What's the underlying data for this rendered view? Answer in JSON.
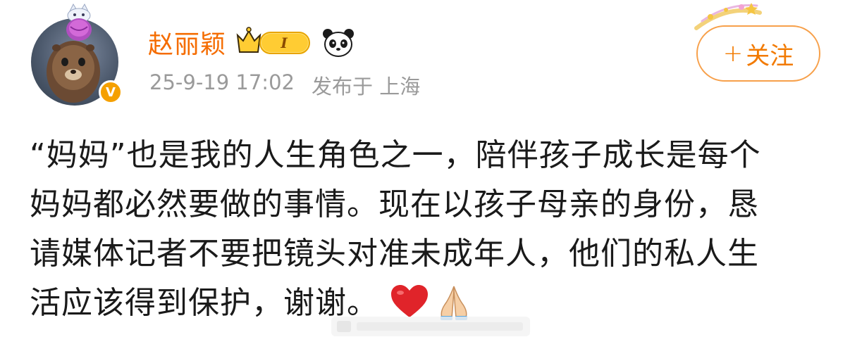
{
  "post": {
    "author": {
      "name": "赵丽颖",
      "level_label": "I",
      "verified_mark": "V"
    },
    "meta": {
      "datetime": "25-9-19 17:02",
      "location": "发布于 上海"
    },
    "follow": {
      "plus": "+",
      "label": "关注"
    },
    "body_lines": [
      "“妈妈”也是我的人生角色之一，陪伴孩子成长是每个",
      "妈妈都必然要做的事情。现在以孩子母亲的身份，恳",
      "请媒体记者不要把镜头对准未成年人，他们的私人生",
      "活应该得到保护，谢谢。"
    ],
    "emojis": [
      "heart-emoji",
      "pray-emoji"
    ]
  },
  "colors": {
    "username": "#f56c00",
    "follow_border": "#f7a04a",
    "follow_text": "#f27a00",
    "meta_text": "#9a9a9a",
    "body_text": "#1a1a1a",
    "verified_badge": "#f5a000"
  }
}
